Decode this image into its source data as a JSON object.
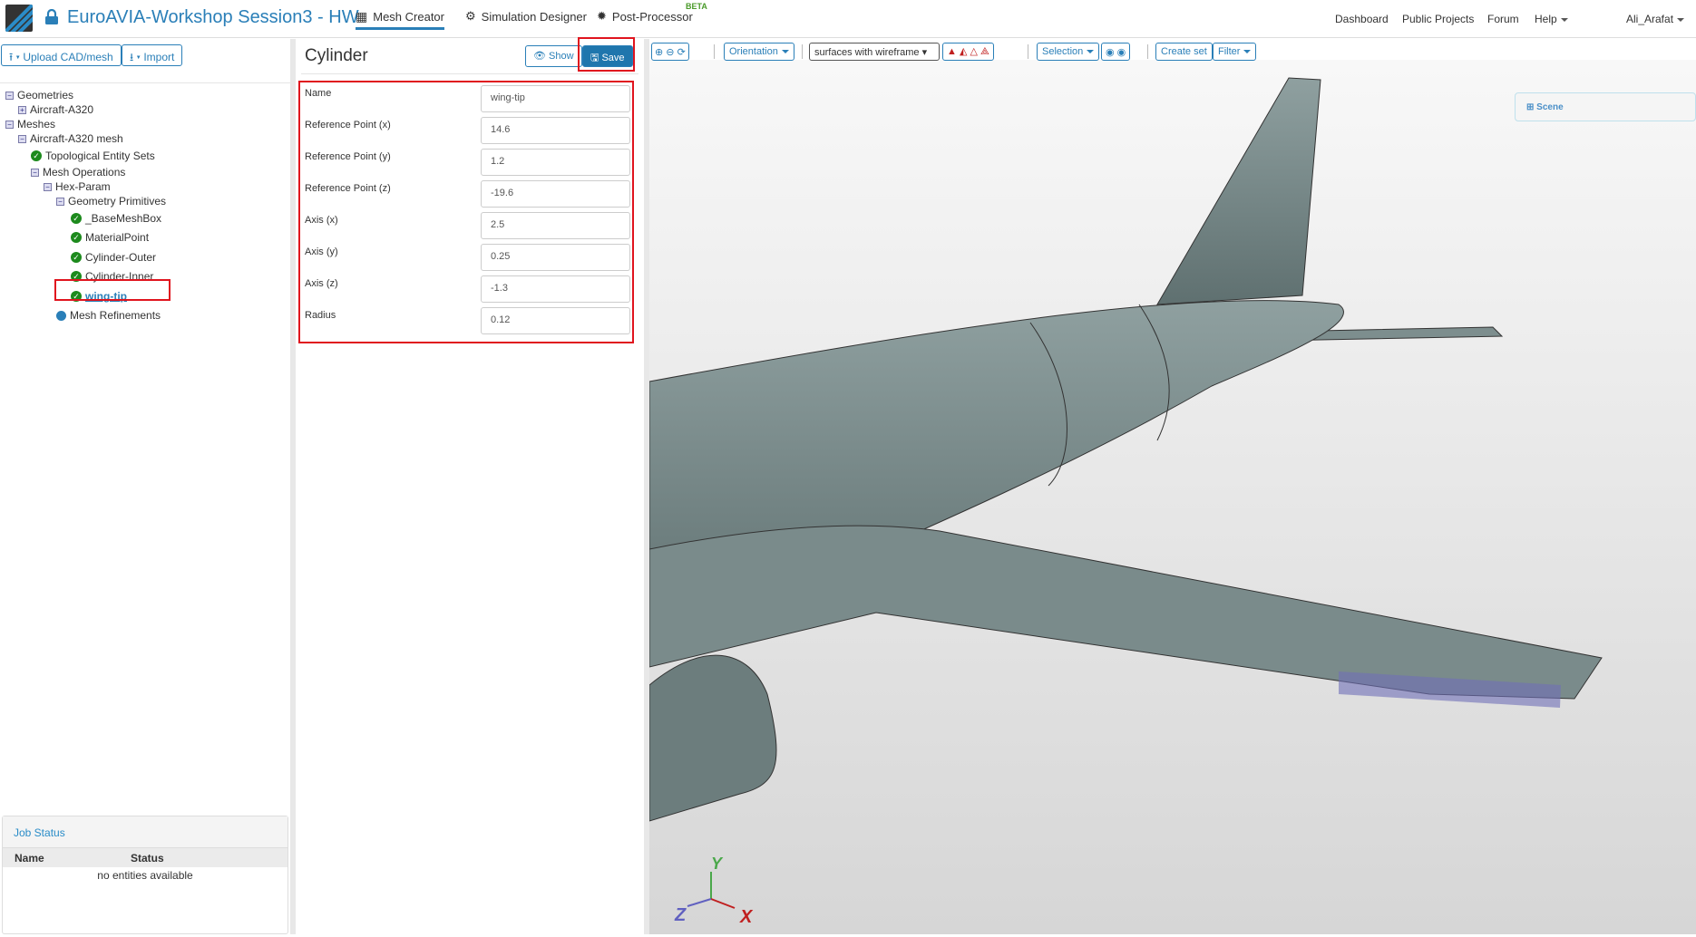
{
  "header": {
    "title": "EuroAVIA-Workshop Session3 - HW",
    "tabs": [
      {
        "label": "Mesh Creator",
        "active": true
      },
      {
        "label": "Simulation Designer"
      },
      {
        "label": "Post-Processor",
        "badge": "BETA"
      }
    ],
    "right_nav": [
      "Dashboard",
      "Public Projects",
      "Forum",
      "Help"
    ],
    "user": "Ali_Arafat"
  },
  "left": {
    "upload_label": "Upload CAD/mesh",
    "import_label": "Import",
    "tree": [
      {
        "label": "Geometries",
        "icon": "minus"
      },
      {
        "label": "Aircraft-A320",
        "icon": "plus"
      },
      {
        "label": "Meshes",
        "icon": "minus"
      },
      {
        "label": "Aircraft-A320 mesh",
        "icon": "minus"
      },
      {
        "label": "Topological Entity Sets",
        "icon": "check"
      },
      {
        "label": "Mesh Operations",
        "icon": "minus"
      },
      {
        "label": "Hex-Param",
        "icon": "minus"
      },
      {
        "label": "Geometry Primitives",
        "icon": "minus"
      },
      {
        "label": "_BaseMeshBox",
        "icon": "check"
      },
      {
        "label": "MaterialPoint",
        "icon": "check"
      },
      {
        "label": "Cylinder-Outer",
        "icon": "check"
      },
      {
        "label": "Cylinder-Inner",
        "icon": "check"
      },
      {
        "label": "wing-tip",
        "icon": "check",
        "selected": true
      },
      {
        "label": "Mesh Refinements",
        "icon": "dot"
      }
    ],
    "job_status": {
      "title": "Job Status",
      "columns": [
        "Name",
        "Status"
      ],
      "empty": "no entities available"
    }
  },
  "editor": {
    "title": "Cylinder",
    "show_label": "Show",
    "save_label": "Save",
    "fields": [
      {
        "label": "Name",
        "value": "wing-tip"
      },
      {
        "label": "Reference Point (x)",
        "value": "14.6"
      },
      {
        "label": "Reference Point (y)",
        "value": "1.2"
      },
      {
        "label": "Reference Point (z)",
        "value": "-19.6"
      },
      {
        "label": "Axis (x)",
        "value": "2.5"
      },
      {
        "label": "Axis (y)",
        "value": "0.25"
      },
      {
        "label": "Axis (z)",
        "value": "-1.3"
      },
      {
        "label": "Radius",
        "value": "0.12"
      }
    ]
  },
  "viewer": {
    "orientation_label": "Orientation",
    "render_mode": "surfaces with wireframe",
    "selection_label": "Selection",
    "create_set_label": "Create set",
    "filter_label": "Filter",
    "scene_label": "Scene",
    "axes": {
      "x": "X",
      "y": "Y",
      "z": "Z"
    }
  }
}
